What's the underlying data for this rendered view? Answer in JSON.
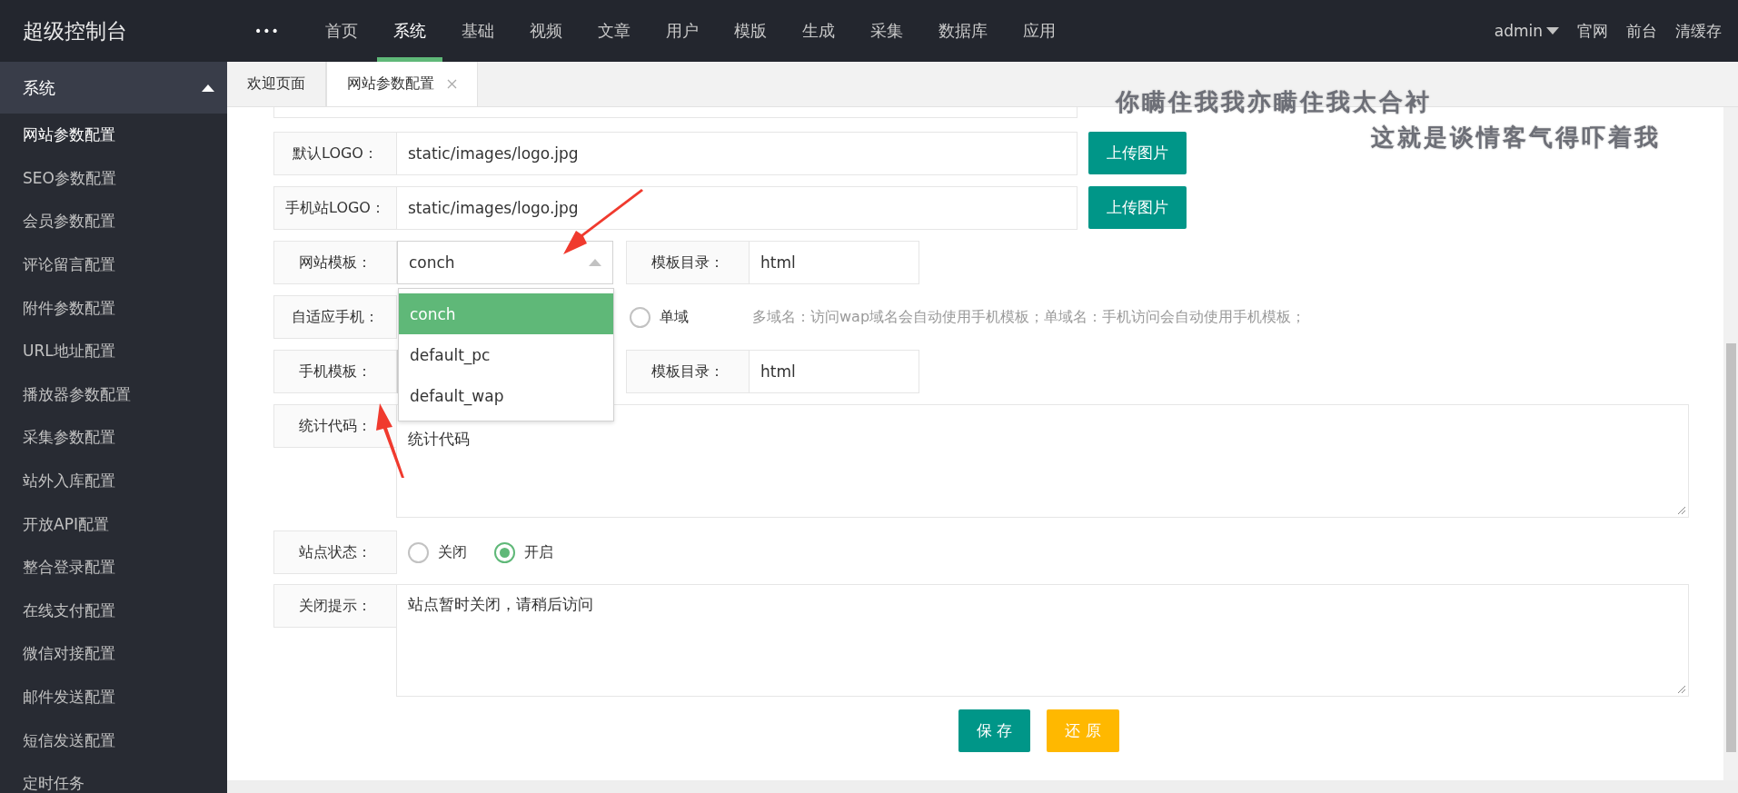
{
  "topbar": {
    "logo": "超级控制台",
    "more": "•••",
    "nav": [
      {
        "label": "首页",
        "selected": false
      },
      {
        "label": "系统",
        "selected": true
      },
      {
        "label": "基础",
        "selected": false
      },
      {
        "label": "视频",
        "selected": false
      },
      {
        "label": "文章",
        "selected": false
      },
      {
        "label": "用户",
        "selected": false
      },
      {
        "label": "模版",
        "selected": false
      },
      {
        "label": "生成",
        "selected": false
      },
      {
        "label": "采集",
        "selected": false
      },
      {
        "label": "数据库",
        "selected": false
      },
      {
        "label": "应用",
        "selected": false
      }
    ],
    "user": "admin",
    "links": [
      "官网",
      "前台",
      "清缓存"
    ]
  },
  "sidebar": {
    "header": {
      "label": "系统",
      "expanded": true
    },
    "items": [
      {
        "label": "网站参数配置",
        "selected": true
      },
      {
        "label": "SEO参数配置",
        "selected": false
      },
      {
        "label": "会员参数配置",
        "selected": false
      },
      {
        "label": "评论留言配置",
        "selected": false
      },
      {
        "label": "附件参数配置",
        "selected": false
      },
      {
        "label": "URL地址配置",
        "selected": false
      },
      {
        "label": "播放器参数配置",
        "selected": false
      },
      {
        "label": "采集参数配置",
        "selected": false
      },
      {
        "label": "站外入库配置",
        "selected": false
      },
      {
        "label": "开放API配置",
        "selected": false
      },
      {
        "label": "整合登录配置",
        "selected": false
      },
      {
        "label": "在线支付配置",
        "selected": false
      },
      {
        "label": "微信对接配置",
        "selected": false
      },
      {
        "label": "邮件发送配置",
        "selected": false
      },
      {
        "label": "短信发送配置",
        "selected": false
      },
      {
        "label": "定时任务",
        "selected": false
      }
    ]
  },
  "tabs": [
    {
      "label": "欢迎页面",
      "selected": false,
      "closable": false
    },
    {
      "label": "网站参数配置",
      "selected": true,
      "closable": true
    }
  ],
  "lyrics": [
    "你瞒住我我亦瞒住我太合衬",
    "这就是谈情客气得吓着我"
  ],
  "form": [
    {
      "kind": "text",
      "label": "默认LOGO：",
      "value": "static/images/logo.jpg",
      "button": "上传图片"
    },
    {
      "kind": "text",
      "label": "手机站LOGO：",
      "value": "static/images/logo.jpg",
      "button": "上传图片"
    },
    {
      "kind": "select",
      "label": "网站模板：",
      "value": "conch",
      "open": true,
      "options": [
        {
          "label": "conch",
          "selected": true
        },
        {
          "label": "default_pc",
          "selected": false
        },
        {
          "label": "default_wap",
          "selected": false
        }
      ],
      "extra": {
        "label": "模板目录：",
        "value": "html"
      }
    },
    {
      "kind": "radio",
      "label": "自适应手机：",
      "options": [
        {
          "label": "单域",
          "selected": false
        }
      ],
      "hint": "多域名：访问wap域名会自动使用手机模板；单域名：手机访问会自动使用手机模板；"
    },
    {
      "kind": "select",
      "label": "手机模板：",
      "extra": {
        "label": "模板目录：",
        "value": "html"
      }
    },
    {
      "kind": "textarea",
      "label": "统计代码：",
      "value": "统计代码"
    },
    {
      "kind": "radio",
      "label": "站点状态：",
      "options": [
        {
          "label": "关闭",
          "selected": false
        },
        {
          "label": "开启",
          "selected": true
        }
      ]
    },
    {
      "kind": "textarea",
      "label": "关闭提示：",
      "value": "站点暂时关闭，请稍后访问"
    }
  ],
  "actions": [
    {
      "label": "保 存",
      "kind": "primary"
    },
    {
      "label": "还 原",
      "kind": "warm"
    }
  ]
}
